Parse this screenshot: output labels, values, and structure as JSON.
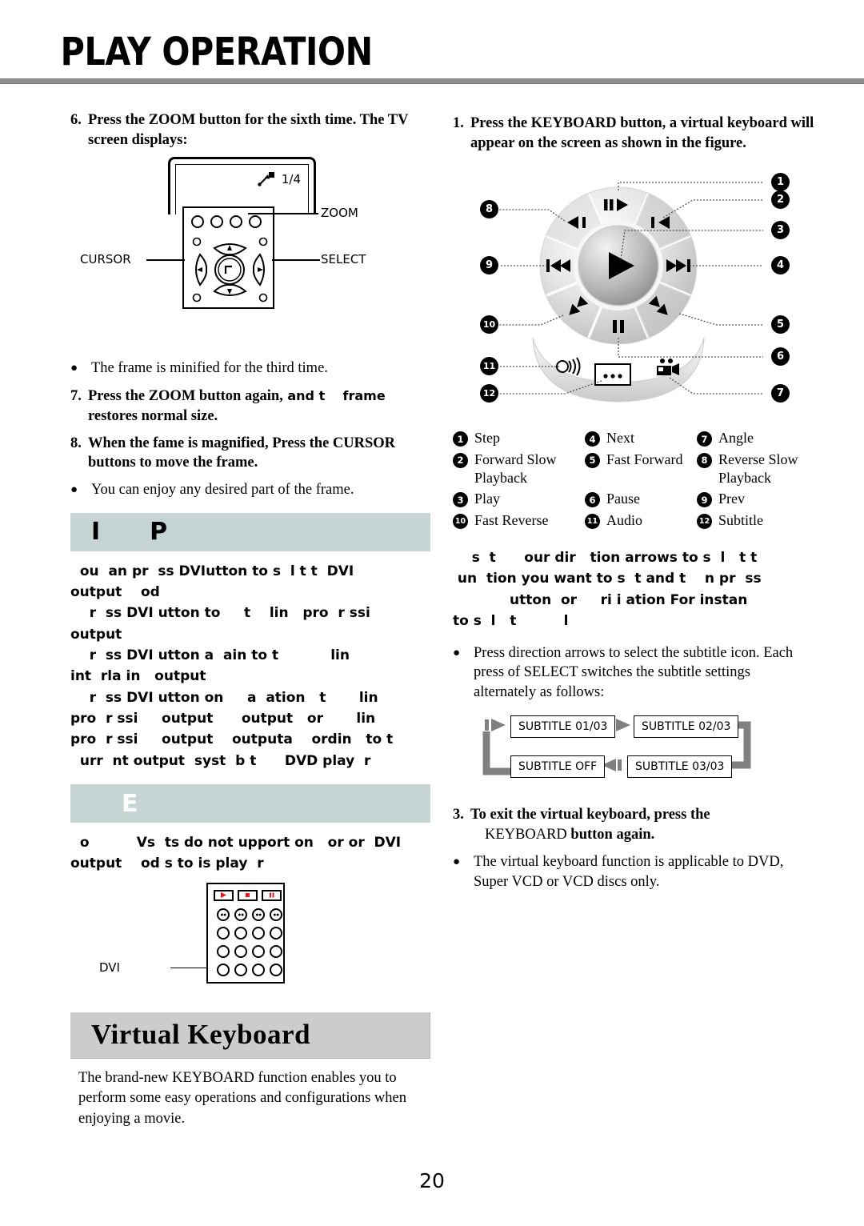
{
  "header": {
    "title": "PLAY OPERATION"
  },
  "page_number": "20",
  "left_column": {
    "step6": {
      "num": "6.",
      "text": "Press the ZOOM button for the sixth time. The TV screen displays:"
    },
    "tv_figure": {
      "zoom_indicator": "1/4",
      "label_zoom": "ZOOM",
      "label_select": "SELECT",
      "label_cursor": "CURSOR"
    },
    "bullet_minified": "The frame is minified for the third time.",
    "step7": {
      "num": "7.",
      "text_bold": "Press the ZOOM button again,",
      "text_faded": " and t    frame",
      "text_line2": "restores normal size."
    },
    "step8": {
      "num": "8.",
      "text": "When the fame is magnified, Press the CURSOR buttons to move the frame."
    },
    "bullet_enjoy": "You can enjoy any desired part of the frame.",
    "bar_dvi": {
      "glyph_left": "I",
      "glyph_right": "P"
    },
    "dvi_body": "  ou  an pr  ss DVIutton to s  l t t  DVI\noutput    od\n    r  ss DVI utton to     t    lin   pro  r ssi\noutput\n    r  ss DVI utton a  ain to t           lin\nint  rla in   output\n    r  ss DVI utton on     a  ation   t       lin\npro  r ssi     output      output   or       lin\npro  r ssi     output    outputa    ordin   to t\n  urr  nt output  syst  b t      DVD play  r",
    "bar_note": {
      "glyph": "E"
    },
    "note_body": "  o          Vs  ts do not upport on   or or  DVI\noutput    od s to is play  r",
    "dvi_figure": {
      "label": "DVI"
    },
    "bar_virtual_keyboard": "Virtual Keyboard",
    "vk_intro": "The brand-new  KEYBOARD function enables you to perform some easy operations and configurations when enjoying a movie."
  },
  "right_column": {
    "step1": {
      "num": "1.",
      "text": "Press the KEYBOARD button, a virtual keyboard will appear on the screen as shown in the figure."
    },
    "wheel": {
      "callouts": [
        "1",
        "2",
        "3",
        "4",
        "5",
        "6",
        "7",
        "8",
        "9",
        "10",
        "11",
        "12"
      ],
      "segment_icons": [
        "step-icon",
        "forward-slow-icon",
        "fast-forward-icon",
        "pause-icon",
        "fast-reverse-icon",
        "prev-icon",
        "reverse-slow-icon"
      ],
      "center_icon": "play-icon",
      "crescent_icons": [
        "audio-icon",
        "subtitle-icon",
        "angle-icon"
      ]
    },
    "legend": [
      {
        "num": "1",
        "label": "Step"
      },
      {
        "num": "4",
        "label": "Next"
      },
      {
        "num": "7",
        "label": "Angle"
      },
      {
        "num": "2",
        "label": "Forward Slow Playback"
      },
      {
        "num": "5",
        "label": "Fast Forward"
      },
      {
        "num": "8",
        "label": "Reverse Slow Playback"
      },
      {
        "num": "3",
        "label": "Play"
      },
      {
        "num": "6",
        "label": "Pause"
      },
      {
        "num": "9",
        "label": "Prev"
      },
      {
        "num": "10",
        "label": "Fast Reverse"
      },
      {
        "num": "11",
        "label": "Audio"
      },
      {
        "num": "12",
        "label": "Subtitle"
      }
    ],
    "step2_faded": "    s  t      our dir   tion arrows to s  l   t t\n un  tion you want to s  t and t    n pr  ss\n            utton  or     ri i ation For instan\nto s  l   t          l",
    "bullet_subtitle": "Press direction arrows to select the subtitle icon. Each press of SELECT switches the subtitle settings alternately as follows:",
    "subtitle_flow": {
      "box1": "SUBTITLE 01/03",
      "box2": "SUBTITLE 02/03",
      "box3": "SUBTITLE 03/03",
      "box4": "SUBTITLE OFF"
    },
    "step3": {
      "num": "3.",
      "text_bold": "To exit the virtual keyboard, press the",
      "text_regular": "KEYBOARD",
      "text_bold2": " button again."
    },
    "bullet_applicable": "The virtual keyboard function is applicable to DVD, Super VCD or VCD discs only."
  },
  "colors": {
    "bar_blue_grey": "#c6d4d4",
    "bar_grey": "#cccccc",
    "rule_grey": "#8f8f8f",
    "accent_red": "#e8141e",
    "flow_arrow_grey": "#808080"
  }
}
